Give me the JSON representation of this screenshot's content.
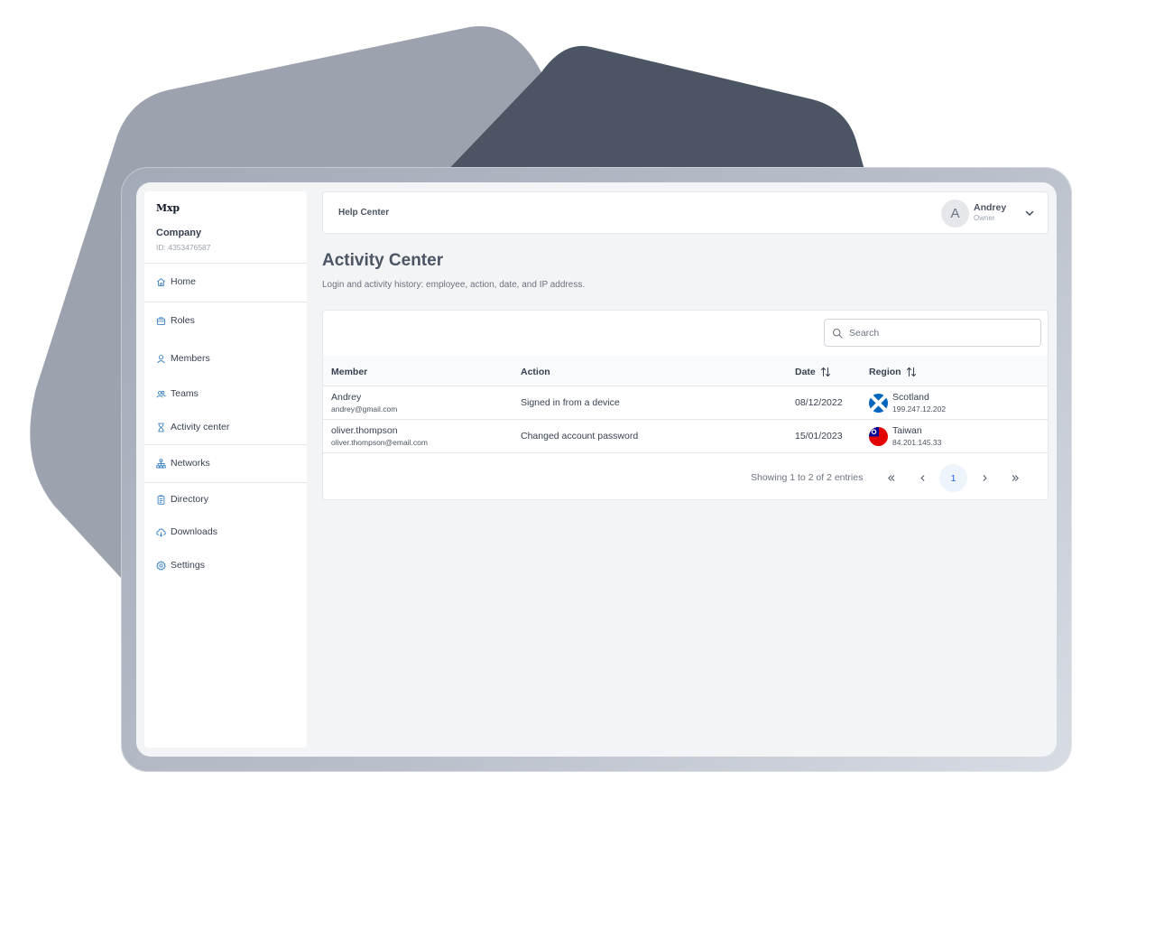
{
  "sidebar": {
    "logo": "Mxp",
    "company_name": "Company",
    "company_id": "ID: 4353476587",
    "items": [
      {
        "label": "Home",
        "icon": "home-icon"
      },
      {
        "label": "Roles",
        "icon": "briefcase-icon"
      },
      {
        "label": "Members",
        "icon": "user-icon"
      },
      {
        "label": "Teams",
        "icon": "users-icon"
      },
      {
        "label": "Activity center",
        "icon": "hourglass-icon"
      },
      {
        "label": "Networks",
        "icon": "network-icon"
      },
      {
        "label": "Directory",
        "icon": "clipboard-icon"
      },
      {
        "label": "Downloads",
        "icon": "cloud-download-icon"
      },
      {
        "label": "Settings",
        "icon": "gear-icon"
      }
    ]
  },
  "header": {
    "breadcrumb": "Help Center",
    "user": {
      "initial": "A",
      "name": "Andrey",
      "role": "Owner"
    }
  },
  "page": {
    "title": "Activity Center",
    "subtitle": "Login and activity history: employee, action, date, and IP address."
  },
  "search": {
    "placeholder": "Search"
  },
  "table": {
    "columns": [
      "Member",
      "Action",
      "Date",
      "Region"
    ],
    "rows": [
      {
        "name": "Andrey",
        "email": "andrey@gmail.com",
        "action": "Signed in from a device",
        "date": "08/12/2022",
        "region": "Scotland",
        "ip": "199.247.12.202",
        "flag": "scotland-flag-icon"
      },
      {
        "name": "oliver.thompson",
        "email": "oliver.thompson@email.com",
        "action": "Changed account password",
        "date": "15/01/2023",
        "region": "Taiwan",
        "ip": "84.201.145.33",
        "flag": "taiwan-flag-icon"
      }
    ]
  },
  "pagination": {
    "info": "Showing 1 to 2 of 2 entries",
    "current_page": "1"
  },
  "colors": {
    "accent": "#2563eb",
    "icon_blue": "#3b82c4",
    "background_shape_light": "#9ca3af",
    "background_shape_dark": "#4b5563",
    "screen_bg": "#f3f4f6"
  }
}
